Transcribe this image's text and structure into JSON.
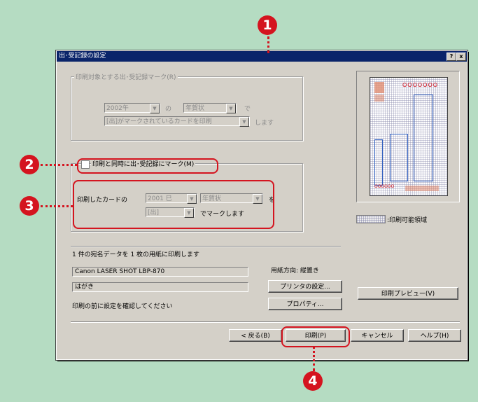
{
  "callouts": [
    "1",
    "2",
    "3",
    "4"
  ],
  "window": {
    "title": "出･受記録の設定",
    "help_btn": "?",
    "close_btn": "x"
  },
  "target_group": {
    "legend": "印刷対象とする出･受記録マーク(R)",
    "year": "2002午",
    "no": "の",
    "type": "年賀状",
    "de": "で",
    "filter": "[出]がマークされているカードを印刷",
    "shimasu": "します"
  },
  "mark_group": {
    "checkbox_label": "印刷と同時に出･受記録にマーク(M)",
    "printed_card": "印刷したカードの",
    "year": "2001 巳",
    "type": "年賀状",
    "wo": "を",
    "mark": "[出]",
    "suffix": "でマークします"
  },
  "preview": {
    "legend_text": ":印刷可能領域",
    "marks": "OOOOOOO",
    "marks2": "OOOOOO"
  },
  "summary": "1 件の宛名データを 1 枚の用紙に印刷します",
  "printer": {
    "name": "Canon LASER SHOT LBP-870",
    "paper": "はがき",
    "orientation": "用紙方向: 縦置き"
  },
  "printer_settings_btn": "プリンタの設定...",
  "properties_btn": "プロパティ...",
  "confirm_text": "印刷の前に設定を確認してください",
  "preview_btn": "印刷プレビュー(V)",
  "footer": {
    "back": "< 戻る(B)",
    "print": "印刷(P)",
    "cancel": "キャンセル",
    "help": "ヘルプ(H)"
  },
  "colors": {
    "accent": "#d4141f",
    "titlebar": "#0a246a",
    "background": "#b5dcc2"
  }
}
